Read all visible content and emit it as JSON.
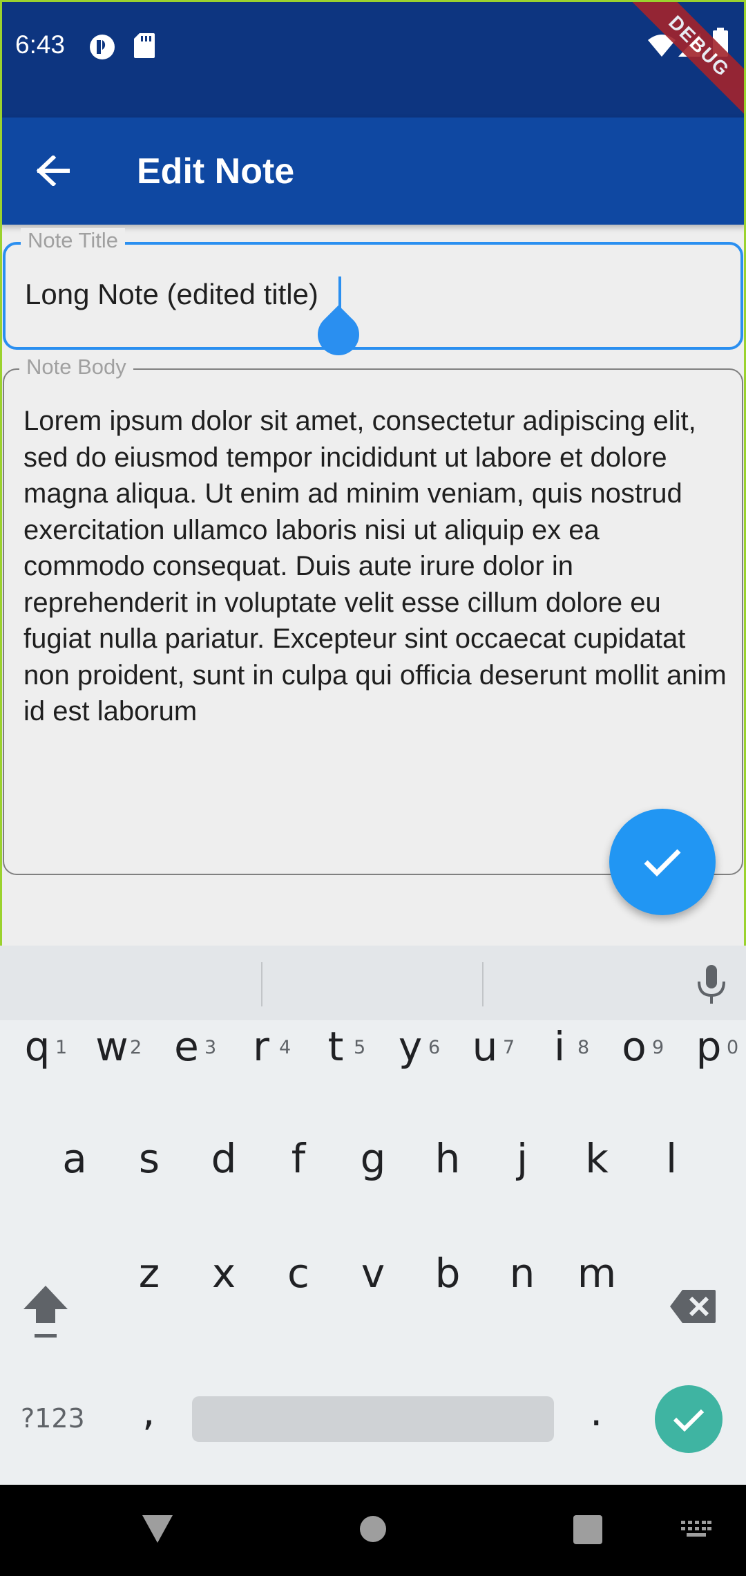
{
  "status_bar": {
    "time": "6:43",
    "icons_left": [
      "app-notification-icon",
      "sd-card-icon"
    ],
    "icons_right": [
      "wifi-icon",
      "signal-icon",
      "battery-icon"
    ],
    "debug_banner": "DEBUG"
  },
  "app_bar": {
    "title": "Edit Note",
    "back_icon": "arrow-back-icon"
  },
  "form": {
    "title_label": "Note Title",
    "title_value": "Long Note (edited title)",
    "body_label": "Note Body",
    "body_value": "Lorem ipsum dolor sit amet, consectetur adipiscing elit, sed do eiusmod tempor incididunt ut labore et dolore magna aliqua. Ut enim ad minim veniam, quis nostrud exercitation ullamco laboris nisi ut aliquip ex ea commodo consequat. Duis aute irure dolor in reprehenderit in voluptate velit esse cillum dolore eu fugiat nulla pariatur. Excepteur sint occaecat cupidatat non proident, sunt in culpa qui officia deserunt mollit anim id est laborum"
  },
  "fab": {
    "icon": "check-icon"
  },
  "keyboard": {
    "row1": [
      "q",
      "w",
      "e",
      "r",
      "t",
      "y",
      "u",
      "i",
      "o",
      "p"
    ],
    "row1_hints": [
      "1",
      "2",
      "3",
      "4",
      "5",
      "6",
      "7",
      "8",
      "9",
      "0"
    ],
    "row2": [
      "a",
      "s",
      "d",
      "f",
      "g",
      "h",
      "j",
      "k",
      "l"
    ],
    "row3": [
      "z",
      "x",
      "c",
      "v",
      "b",
      "n",
      "m"
    ],
    "symbols_label": "?123",
    "comma": ",",
    "period": ".",
    "mic_icon": "microphone-icon",
    "shift_icon": "shift-icon",
    "backspace_icon": "backspace-icon",
    "enter_icon": "check-icon"
  },
  "nav_bar": {
    "buttons": [
      "back-triangle-icon",
      "home-circle-icon",
      "recents-square-icon",
      "keyboard-switch-icon"
    ]
  },
  "colors": {
    "status_bar": "#0d3580",
    "app_bar": "#0f48a2",
    "accent": "#2196f3",
    "enter_key": "#3fb4a2",
    "keyboard_bg": "#eceff1"
  }
}
